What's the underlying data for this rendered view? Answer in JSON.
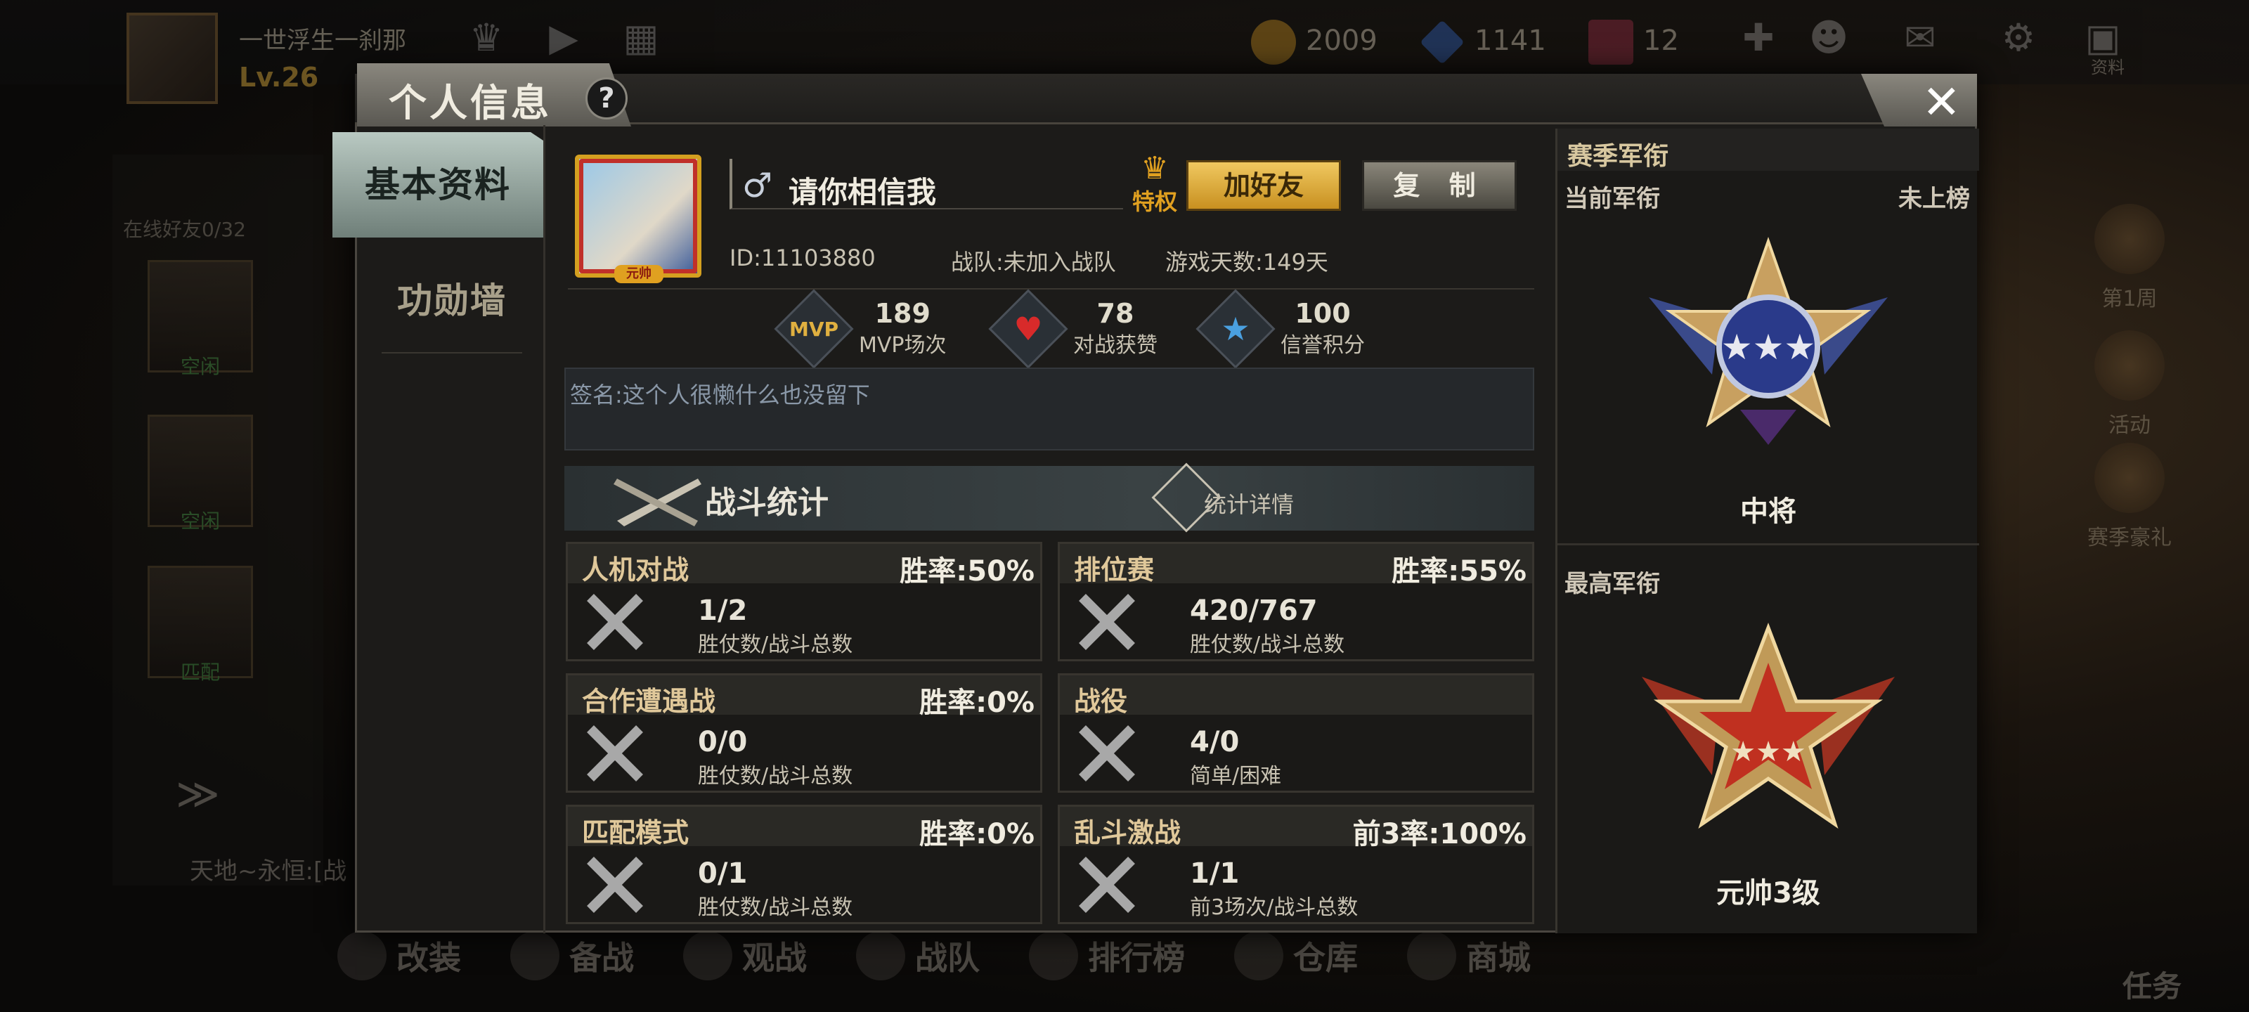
{
  "lobby": {
    "player_name": "一世浮生一刹那",
    "level": "Lv.26",
    "currency": [
      {
        "name": "gold-coin",
        "value": "2009",
        "color": "#d4a020"
      },
      {
        "name": "diamond",
        "value": "1141",
        "color": "#3a7ad0"
      },
      {
        "name": "card",
        "value": "12",
        "color": "#b03050"
      }
    ],
    "online_friends": "在线好友0/32",
    "friend_slots": [
      "空闲",
      "空闲",
      "匹配"
    ],
    "chat_preview": "天地~永恒:[战",
    "right_side": [
      "第1周",
      "活动",
      "赛季豪礼"
    ],
    "bottom_nav": [
      "改装",
      "备战",
      "观战",
      "战队",
      "排行榜",
      "仓库",
      "商城"
    ],
    "task": "任务",
    "top_icon_label": "资料"
  },
  "modal": {
    "title": "个人信息",
    "help": "?",
    "close": "✕",
    "tabs": [
      {
        "label": "基本资料",
        "active": true
      },
      {
        "label": "功勋墙",
        "active": false
      }
    ]
  },
  "profile": {
    "avatar_badge": "元帅",
    "gender_symbol": "♂",
    "name": "请你相信我",
    "privilege": "特权",
    "add_friend": "加好友",
    "copy": "复 制",
    "id": "ID:11103880",
    "team": "战队:未加入战队",
    "days": "游戏天数:149天",
    "stats": [
      {
        "icon": "MVP",
        "value": "189",
        "label": "MVP场次"
      },
      {
        "icon": "heart",
        "value": "78",
        "label": "对战获赞"
      },
      {
        "icon": "star",
        "value": "100",
        "label": "信誉积分"
      }
    ],
    "signature": "签名:这个人很懒什么也没留下"
  },
  "battle": {
    "title": "战斗统计",
    "details": "统计详情",
    "cards": [
      {
        "name": "人机对战",
        "rate": "胜率:50%",
        "value": "1/2",
        "sub": "胜仗数/战斗总数"
      },
      {
        "name": "排位赛",
        "rate": "胜率:55%",
        "value": "420/767",
        "sub": "胜仗数/战斗总数"
      },
      {
        "name": "合作遭遇战",
        "rate": "胜率:0%",
        "value": "0/0",
        "sub": "胜仗数/战斗总数"
      },
      {
        "name": "战役",
        "rate": "",
        "value": "4/0",
        "sub": "简单/困难"
      },
      {
        "name": "匹配模式",
        "rate": "胜率:0%",
        "value": "0/1",
        "sub": "胜仗数/战斗总数"
      },
      {
        "name": "乱斗激战",
        "rate": "前3率:100%",
        "value": "1/1",
        "sub": "前3场次/战斗总数"
      }
    ]
  },
  "rank": {
    "header": "赛季军衔",
    "current_label": "当前军衔",
    "current_status": "未上榜",
    "current_rank": "中将",
    "highest_label": "最高军衔",
    "highest_rank": "元帅3级"
  }
}
